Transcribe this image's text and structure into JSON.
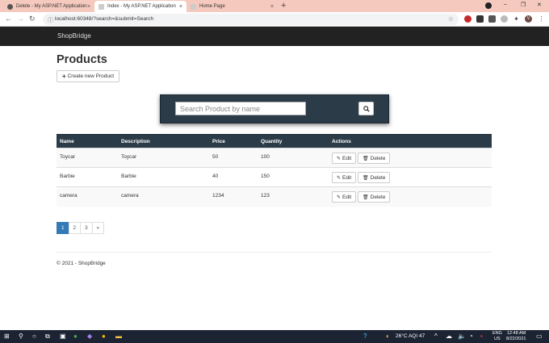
{
  "browser": {
    "tabs": [
      {
        "label": "Delete - My ASP.NET Application",
        "close": "×"
      },
      {
        "label": "Index - My ASP.NET Application",
        "close": "×"
      },
      {
        "label": "Home Page",
        "close": "×"
      }
    ],
    "new_tab": "+",
    "url": "localhost:60348/?search=&submit=Search",
    "window_controls": {
      "minimize": "–",
      "maximize": "❐",
      "close": "✕"
    },
    "profile_initial": "V"
  },
  "app": {
    "brand": "ShopBridge",
    "page_title": "Products",
    "create_button": "Create new Product",
    "search": {
      "placeholder": "Search Product by name",
      "value": ""
    },
    "table": {
      "headers": [
        "Name",
        "Description",
        "Price",
        "Quantity",
        "Actions"
      ],
      "rows": [
        {
          "name": "Toycar",
          "description": "Toycar",
          "price": "50",
          "quantity": "100"
        },
        {
          "name": "Barbie",
          "description": "Barbie",
          "price": "40",
          "quantity": "150"
        },
        {
          "name": "camera",
          "description": "camera",
          "price": "1234",
          "quantity": "123"
        }
      ],
      "edit_label": "Edit",
      "delete_label": "Delete"
    },
    "pagination": {
      "pages": [
        "1",
        "2",
        "3"
      ],
      "next": "»",
      "current": "1"
    },
    "footer": "© 2021 - ShopBridge"
  },
  "taskbar": {
    "weather": "26°C  AQI 47",
    "lang": "ENG",
    "region": "US",
    "time": "12:48 AM",
    "date": "8/22/2021"
  },
  "colors": {
    "table_header": "#2b3b48",
    "navbar": "#222222",
    "pager_active": "#337ab7",
    "tabbar": "#f5c9bd"
  }
}
